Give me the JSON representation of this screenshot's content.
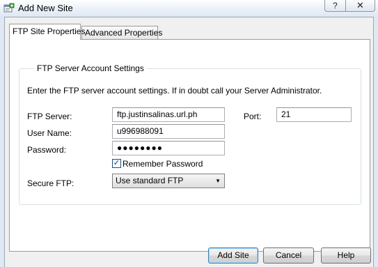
{
  "window": {
    "title": "Add New Site",
    "help_label": "?",
    "close_label": "✕"
  },
  "tabs": [
    {
      "label": "FTP Site Properties",
      "active": true
    },
    {
      "label": "Advanced Properties",
      "active": false
    }
  ],
  "group": {
    "title": "FTP Server Account Settings",
    "instructions": "Enter the FTP server account settings. If in doubt call your Server Administrator."
  },
  "form": {
    "server_label": "FTP Server:",
    "server_value": "ftp.justinsalinas.url.ph",
    "port_label": "Port:",
    "port_value": "21",
    "username_label": "User Name:",
    "username_value": "u996988091",
    "password_label": "Password:",
    "password_mask": "●●●●●●●●",
    "remember_label": "Remember Password",
    "remember_checked": true,
    "remember_check_glyph": "✓",
    "secure_label": "Secure FTP:",
    "secure_value": "Use standard FTP",
    "secure_arrow": "▼"
  },
  "buttons": {
    "add_site": "Add Site",
    "cancel": "Cancel",
    "help": "Help"
  },
  "icons": {
    "app_icon": "add-site-icon",
    "dropdown": "chevron-down-icon"
  },
  "colors": {
    "window_frame": "#dfe8f3",
    "default_button_border": "#3c7fb1",
    "panel_background": "#ffffff"
  }
}
